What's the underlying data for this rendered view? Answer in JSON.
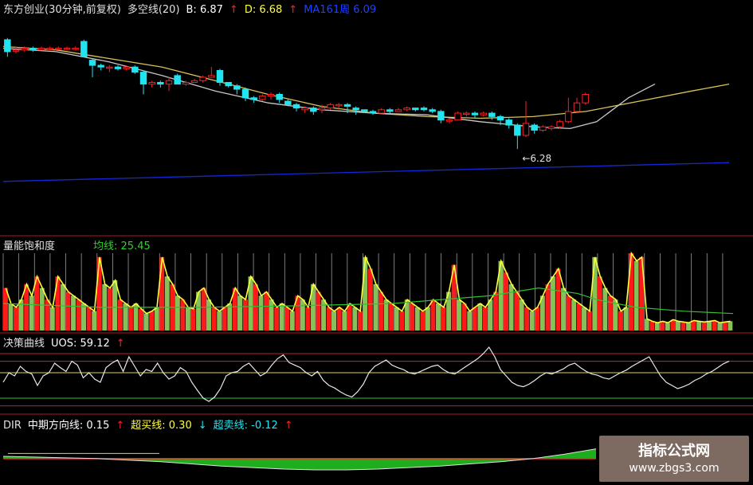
{
  "colors": {
    "up": "#ff2020",
    "down": "#22e4f0",
    "ma_yellow": "#d9c25a",
    "ma_white": "#c8c8c8",
    "ma_blue": "#1428d8",
    "vol_red": "#ff1a1a",
    "vol_green": "#88c058",
    "line_yellow": "#ffff40",
    "line_green": "#30c030",
    "divider": "#b01a1a"
  },
  "panels": {
    "main": {
      "title": "东方创业(30分钟,前复权)",
      "ma_label": "多空线(20)",
      "b_label": "B: 6.87",
      "d_label": "D: 6.68",
      "ma3_label": "MA161周  6.09",
      "low_marker": "6.28",
      "up_arrow": "↑"
    },
    "vol": {
      "title": "量能饱和度",
      "avg_label": "均线: 25.45"
    },
    "uos": {
      "title": "决策曲线",
      "value_label": "UOS: 59.12",
      "up_arrow": "↑"
    },
    "dir": {
      "title": "DIR",
      "mid_label": "中期方向线: 0.15",
      "buy_label": "超买线: 0.30",
      "sell_label": "超卖线: -0.12",
      "up_arrow": "↑",
      "down_arrow": "↓"
    }
  },
  "watermark": {
    "line1": "指标公式网",
    "line2": "www.zbgs3.com"
  },
  "chart_data": [
    {
      "type": "candlestick",
      "name": "main",
      "ylim": [
        5.8,
        7.05
      ],
      "candles": [
        [
          6.92,
          6.85,
          6.93,
          6.82
        ],
        [
          6.86,
          6.86,
          6.88,
          6.84
        ],
        [
          6.86,
          6.87,
          6.88,
          6.85
        ],
        [
          6.87,
          6.86,
          6.88,
          6.85
        ],
        [
          6.86,
          6.87,
          6.88,
          6.86
        ],
        [
          6.87,
          6.87,
          6.88,
          6.86
        ],
        [
          6.87,
          6.87,
          6.88,
          6.86
        ],
        [
          6.87,
          6.87,
          6.88,
          6.86
        ],
        [
          6.87,
          6.87,
          6.88,
          6.86
        ],
        [
          6.91,
          6.82,
          6.92,
          6.82
        ],
        [
          6.8,
          6.77,
          6.81,
          6.7
        ],
        [
          6.77,
          6.76,
          6.78,
          6.74
        ],
        [
          6.76,
          6.76,
          6.77,
          6.73
        ],
        [
          6.76,
          6.75,
          6.77,
          6.74
        ],
        [
          6.75,
          6.76,
          6.77,
          6.74
        ],
        [
          6.76,
          6.73,
          6.77,
          6.72
        ],
        [
          6.73,
          6.66,
          6.74,
          6.6
        ],
        [
          6.66,
          6.67,
          6.68,
          6.64
        ],
        [
          6.67,
          6.66,
          6.68,
          6.64
        ],
        [
          6.66,
          6.68,
          6.7,
          6.62
        ],
        [
          6.71,
          6.66,
          6.72,
          6.66
        ],
        [
          6.66,
          6.67,
          6.68,
          6.65
        ],
        [
          6.67,
          6.68,
          6.69,
          6.67
        ],
        [
          6.68,
          6.7,
          6.71,
          6.67
        ],
        [
          6.7,
          6.71,
          6.76,
          6.7
        ],
        [
          6.74,
          6.67,
          6.75,
          6.65
        ],
        [
          6.67,
          6.65,
          6.66,
          6.64
        ],
        [
          6.65,
          6.63,
          6.66,
          6.6
        ],
        [
          6.63,
          6.58,
          6.64,
          6.56
        ],
        [
          6.58,
          6.57,
          6.59,
          6.55
        ],
        [
          6.57,
          6.59,
          6.6,
          6.56
        ],
        [
          6.59,
          6.6,
          6.61,
          6.57
        ],
        [
          6.6,
          6.57,
          6.61,
          6.55
        ],
        [
          6.56,
          6.54,
          6.57,
          6.53
        ],
        [
          6.54,
          6.52,
          6.55,
          6.5
        ],
        [
          6.51,
          6.52,
          6.53,
          6.49
        ],
        [
          6.52,
          6.5,
          6.53,
          6.48
        ],
        [
          6.51,
          6.52,
          6.54,
          6.49
        ],
        [
          6.52,
          6.54,
          6.55,
          6.51
        ],
        [
          6.54,
          6.54,
          6.55,
          6.51
        ],
        [
          6.54,
          6.53,
          6.55,
          6.49
        ],
        [
          6.52,
          6.51,
          6.53,
          6.48
        ],
        [
          6.51,
          6.5,
          6.51,
          6.49
        ],
        [
          6.5,
          6.49,
          6.51,
          6.48
        ],
        [
          6.49,
          6.51,
          6.52,
          6.49
        ],
        [
          6.51,
          6.5,
          6.52,
          6.48
        ],
        [
          6.5,
          6.51,
          6.52,
          6.5
        ],
        [
          6.51,
          6.52,
          6.53,
          6.5
        ],
        [
          6.52,
          6.51,
          6.52,
          6.5
        ],
        [
          6.52,
          6.51,
          6.53,
          6.5
        ],
        [
          6.51,
          6.5,
          6.52,
          6.49
        ],
        [
          6.5,
          6.45,
          6.51,
          6.43
        ],
        [
          6.45,
          6.45,
          6.46,
          6.43
        ],
        [
          6.45,
          6.49,
          6.5,
          6.45
        ],
        [
          6.49,
          6.49,
          6.5,
          6.47
        ],
        [
          6.49,
          6.48,
          6.5,
          6.46
        ],
        [
          6.48,
          6.49,
          6.5,
          6.47
        ],
        [
          6.49,
          6.47,
          6.5,
          6.45
        ],
        [
          6.47,
          6.45,
          6.48,
          6.42
        ],
        [
          6.45,
          6.42,
          6.46,
          6.4
        ],
        [
          6.42,
          6.36,
          6.43,
          6.28
        ],
        [
          6.36,
          6.43,
          6.56,
          6.35
        ],
        [
          6.42,
          6.39,
          6.43,
          6.37
        ],
        [
          6.39,
          6.41,
          6.42,
          6.38
        ],
        [
          6.4,
          6.41,
          6.42,
          6.39
        ],
        [
          6.41,
          6.44,
          6.45,
          6.4
        ],
        [
          6.44,
          6.5,
          6.58,
          6.43
        ],
        [
          6.5,
          6.55,
          6.58,
          6.49
        ],
        [
          6.55,
          6.6,
          6.61,
          6.54
        ]
      ],
      "ma_yellow": [
        [
          0,
          6.88
        ],
        [
          10,
          6.86
        ],
        [
          20,
          6.81
        ],
        [
          30,
          6.76
        ],
        [
          40,
          6.68
        ],
        [
          50,
          6.6
        ],
        [
          60,
          6.53
        ],
        [
          70,
          6.49
        ],
        [
          80,
          6.47
        ],
        [
          90,
          6.46
        ],
        [
          100,
          6.47
        ],
        [
          110,
          6.5
        ],
        [
          120,
          6.56
        ],
        [
          130,
          6.62
        ],
        [
          137,
          6.66
        ]
      ],
      "ma_white": [
        [
          0,
          6.87
        ],
        [
          10,
          6.85
        ],
        [
          20,
          6.79
        ],
        [
          30,
          6.71
        ],
        [
          40,
          6.62
        ],
        [
          50,
          6.55
        ],
        [
          60,
          6.51
        ],
        [
          70,
          6.49
        ],
        [
          80,
          6.48
        ],
        [
          90,
          6.44
        ],
        [
          100,
          6.41
        ],
        [
          107,
          6.4
        ],
        [
          112,
          6.44
        ],
        [
          118,
          6.58
        ],
        [
          123,
          6.66
        ]
      ],
      "ma_blue": [
        [
          0,
          6.09
        ],
        [
          137,
          6.2
        ]
      ]
    },
    {
      "type": "bar",
      "name": "vol",
      "ylim": [
        0,
        100
      ],
      "values": [
        55,
        35,
        30,
        40,
        60,
        45,
        70,
        55,
        40,
        30,
        70,
        60,
        50,
        45,
        40,
        35,
        30,
        25,
        95,
        60,
        55,
        65,
        40,
        35,
        30,
        35,
        28,
        22,
        25,
        30,
        95,
        70,
        60,
        45,
        40,
        30,
        28,
        50,
        55,
        40,
        30,
        25,
        30,
        35,
        55,
        45,
        40,
        70,
        60,
        45,
        50,
        40,
        30,
        35,
        30,
        25,
        45,
        40,
        30,
        60,
        50,
        40,
        30,
        25,
        30,
        25,
        35,
        30,
        25,
        95,
        80,
        60,
        50,
        40,
        35,
        30,
        25,
        40,
        35,
        30,
        25,
        30,
        40,
        35,
        30,
        50,
        85,
        40,
        35,
        25,
        30,
        35,
        30,
        40,
        50,
        90,
        75,
        60,
        50,
        40,
        30,
        25,
        30,
        45,
        60,
        70,
        80,
        55,
        45,
        40,
        35,
        30,
        25,
        95,
        70,
        55,
        45,
        40,
        25,
        30,
        100,
        90,
        95,
        15,
        12,
        10,
        12,
        10,
        14,
        12,
        11,
        10,
        13,
        12,
        11,
        12,
        13,
        10,
        11,
        12
      ],
      "avg": [
        [
          0,
          35
        ],
        [
          20,
          30
        ],
        [
          40,
          30
        ],
        [
          60,
          32
        ],
        [
          80,
          35
        ],
        [
          100,
          45
        ],
        [
          110,
          55
        ],
        [
          118,
          48
        ],
        [
          122,
          40
        ],
        [
          130,
          30
        ],
        [
          140,
          25
        ],
        [
          150,
          22
        ]
      ]
    },
    {
      "type": "line",
      "name": "uos",
      "ylim": [
        0,
        100
      ],
      "values": [
        45,
        60,
        55,
        70,
        62,
        58,
        40,
        55,
        60,
        75,
        68,
        62,
        78,
        72,
        52,
        60,
        50,
        45,
        68,
        75,
        80,
        62,
        85,
        70,
        55,
        65,
        62,
        75,
        60,
        50,
        55,
        68,
        62,
        45,
        32,
        20,
        15,
        22,
        35,
        55,
        60,
        62,
        70,
        75,
        65,
        55,
        60,
        72,
        82,
        88,
        76,
        72,
        68,
        60,
        55,
        62,
        48,
        40,
        36,
        30,
        25,
        22,
        30,
        42,
        60,
        70,
        75,
        80,
        72,
        68,
        65,
        60,
        58,
        62,
        66,
        70,
        72,
        65,
        60,
        58,
        64,
        70,
        76,
        82,
        90,
        100,
        85,
        65,
        55,
        45,
        40,
        38,
        42,
        48,
        55,
        60,
        58,
        62,
        66,
        72,
        75,
        68,
        62,
        58,
        56,
        52,
        50,
        55,
        60,
        64,
        70,
        75,
        80,
        85,
        70,
        55,
        45,
        40,
        35,
        38,
        42,
        48,
        52,
        58,
        62,
        68,
        74,
        78
      ],
      "levels": {
        "red_high": 90,
        "red_upper": 78,
        "yellow": 60,
        "green": 20,
        "red_low": 8
      }
    },
    {
      "type": "area",
      "name": "dir",
      "ylim": [
        -0.3,
        0.4
      ],
      "series": [
        {
          "name": "中期方向线",
          "values": [
            0.05,
            0.04,
            0.03,
            0.02,
            0.0,
            -0.02,
            -0.05,
            -0.08,
            -0.1,
            -0.12,
            -0.13,
            -0.13,
            -0.12,
            -0.1,
            -0.08,
            -0.05,
            -0.02,
            0.02,
            0.08,
            0.15
          ]
        },
        {
          "name": "超买线",
          "values": [
            0.3
          ]
        },
        {
          "name": "超卖线",
          "values": [
            -0.12
          ]
        }
      ]
    }
  ]
}
